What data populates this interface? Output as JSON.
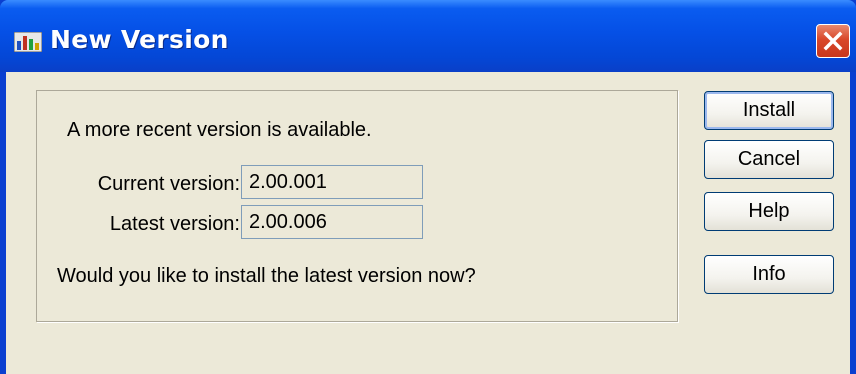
{
  "window": {
    "title": "New Version",
    "app_icon": "bar-chart-icon",
    "close_icon": "close-icon",
    "colors": {
      "titlebar": "#0550e6",
      "close_button": "#d9482a",
      "client": "#ece9d8"
    }
  },
  "dialog": {
    "message": "A more recent version is available.",
    "current_label": "Current version:",
    "current_value": "2.00.001",
    "latest_label": "Latest version:",
    "latest_value": "2.00.006",
    "question": "Would you like to install the latest version now?"
  },
  "buttons": {
    "install": "Install",
    "cancel": "Cancel",
    "help": "Help",
    "info": "Info"
  }
}
